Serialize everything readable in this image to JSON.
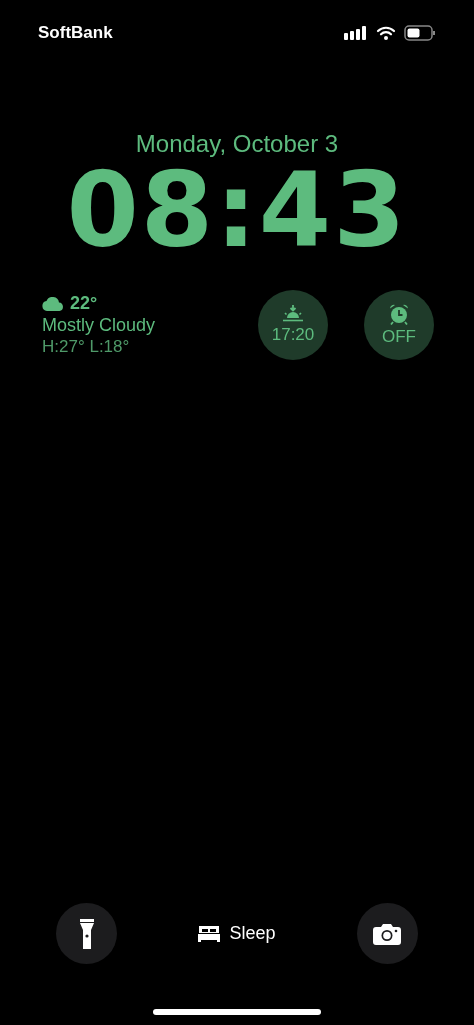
{
  "status_bar": {
    "carrier": "SoftBank"
  },
  "date": "Monday, October 3",
  "time": "08:43",
  "weather": {
    "temperature": "22°",
    "condition": "Mostly Cloudy",
    "range": "H:27° L:18°"
  },
  "widgets": [
    {
      "kind": "sunset",
      "label": "17:20"
    },
    {
      "kind": "alarm",
      "label": "OFF"
    }
  ],
  "focus": {
    "label": "Sleep"
  },
  "quick_actions": [
    {
      "kind": "flashlight"
    },
    {
      "kind": "camera"
    }
  ]
}
